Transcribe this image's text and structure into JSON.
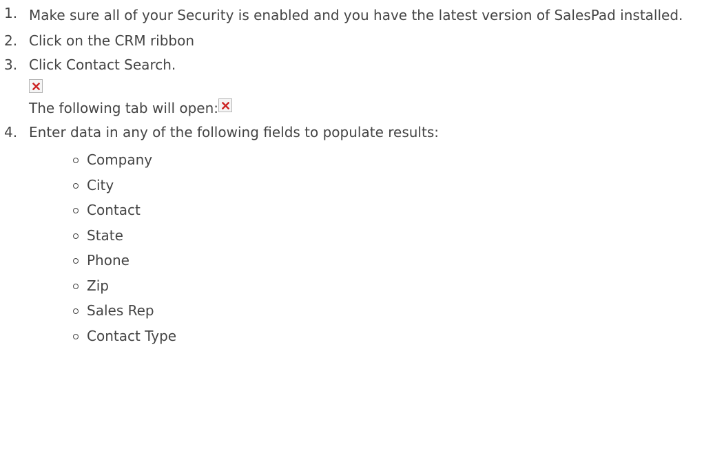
{
  "steps": [
    {
      "number": "1.",
      "text": "Make sure all of your Security is enabled and you have the latest version of SalesPad installed."
    },
    {
      "number": "2.",
      "text": "Click on the CRM ribbon"
    },
    {
      "number": "3.",
      "text": "Click Contact Search.",
      "image_icon": "broken-image-icon",
      "followup_text": "The following tab will open:"
    },
    {
      "number": "4.",
      "text": "Enter data in any of the following fields to populate results:",
      "fields": [
        "Company",
        "City",
        "Contact",
        "State",
        "Phone",
        "Zip",
        "Sales Rep",
        "Contact Type"
      ]
    }
  ],
  "colors": {
    "text": "#444444",
    "broken_image_x": "#cc2222",
    "broken_image_border": "#b5b5b5"
  }
}
